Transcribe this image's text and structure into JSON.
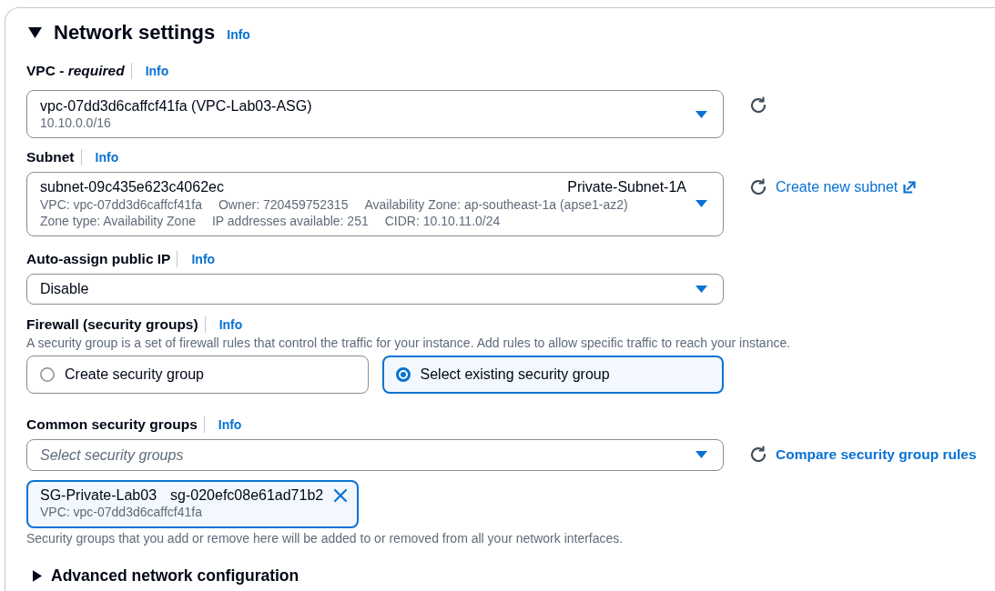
{
  "section": {
    "title": "Network settings",
    "info": "Info",
    "expanded": true
  },
  "vpc": {
    "label": "VPC - *required*",
    "info": "Info",
    "value": "vpc-07dd3d6caffcf41fa (VPC-Lab03-ASG)",
    "detail": "10.10.0.0/16"
  },
  "subnet": {
    "label": "Subnet",
    "info": "Info",
    "value": "subnet-09c435e623c4062ec",
    "tag": "Private-Subnet-1A",
    "details": [
      [
        "VPC: vpc-07dd3d6caffcf41fa",
        "Owner: 720459752315",
        "Availability Zone: ap-southeast-1a (apse1-az2)"
      ],
      [
        "Zone type: Availability Zone",
        "IP addresses available: 251",
        "CIDR: 10.10.11.0/24"
      ]
    ],
    "link": "Create new subnet"
  },
  "auto_assign_public_ip": {
    "label": "Auto-assign public IP",
    "info": "Info",
    "value": "Disable"
  },
  "firewall": {
    "label": "Firewall (security groups)",
    "info": "Info",
    "description": "A security group is a set of firewall rules that control the traffic for your instance. Add rules to allow specific traffic to reach your instance.",
    "options": [
      {
        "label": "Create security group",
        "selected": false
      },
      {
        "label": "Select existing security group",
        "selected": true
      }
    ]
  },
  "common_security_groups": {
    "label": "Common security groups",
    "info": "Info",
    "placeholder": "Select security groups",
    "link": "Compare security group rules",
    "tokens": [
      {
        "name": "SG-Private-Lab03",
        "id": "sg-020efc08e61ad71b2",
        "detail": "VPC: vpc-07dd3d6caffcf41fa"
      }
    ],
    "help": "Security groups that you add or remove here will be added to or removed from all your network interfaces."
  },
  "advanced": {
    "title": "Advanced network configuration",
    "expanded": false
  }
}
